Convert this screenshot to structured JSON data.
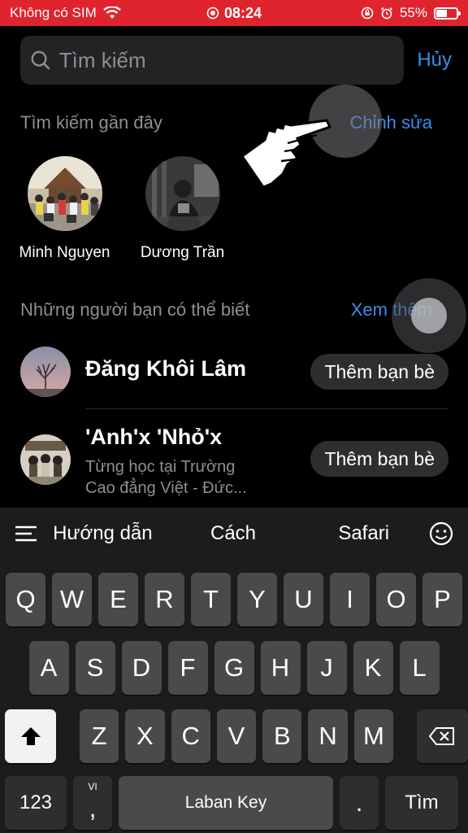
{
  "status": {
    "carrier": "Không có SIM",
    "time": "08:24",
    "battery": "55%",
    "battery_level": 0.55
  },
  "search": {
    "placeholder": "Tìm kiếm",
    "cancel": "Hủy"
  },
  "recent": {
    "title": "Tìm kiếm gần đây",
    "edit": "Chỉnh sửa",
    "items": [
      {
        "name": "Minh Nguyen"
      },
      {
        "name": "Dương Trần"
      }
    ]
  },
  "suggestions": {
    "title": "Những người bạn có thể biết",
    "see_more": "Xem thêm",
    "items": [
      {
        "name": "Đăng Khôi Lâm",
        "subtitle_1": "",
        "subtitle_2": "",
        "action": "Thêm bạn bè"
      },
      {
        "name": "'Anh'x 'Nhỏ'x",
        "subtitle_1": "Từng học tại Trường",
        "subtitle_2": "Cao đẳng Việt - Đức...",
        "action": "Thêm bạn bè"
      }
    ]
  },
  "keyboard": {
    "suggestions": [
      "Hướng dẫn",
      "Cách",
      "Safari"
    ],
    "row1": [
      "Q",
      "W",
      "E",
      "R",
      "T",
      "Y",
      "U",
      "I",
      "O",
      "P"
    ],
    "row2": [
      "A",
      "S",
      "D",
      "F",
      "G",
      "H",
      "J",
      "K",
      "L"
    ],
    "row3": [
      "Z",
      "X",
      "C",
      "V",
      "B",
      "N",
      "M"
    ],
    "numbers": "123",
    "comma": ",",
    "comma_sup": "VI",
    "space": "Laban Key",
    "period": ".",
    "go": "Tìm"
  }
}
